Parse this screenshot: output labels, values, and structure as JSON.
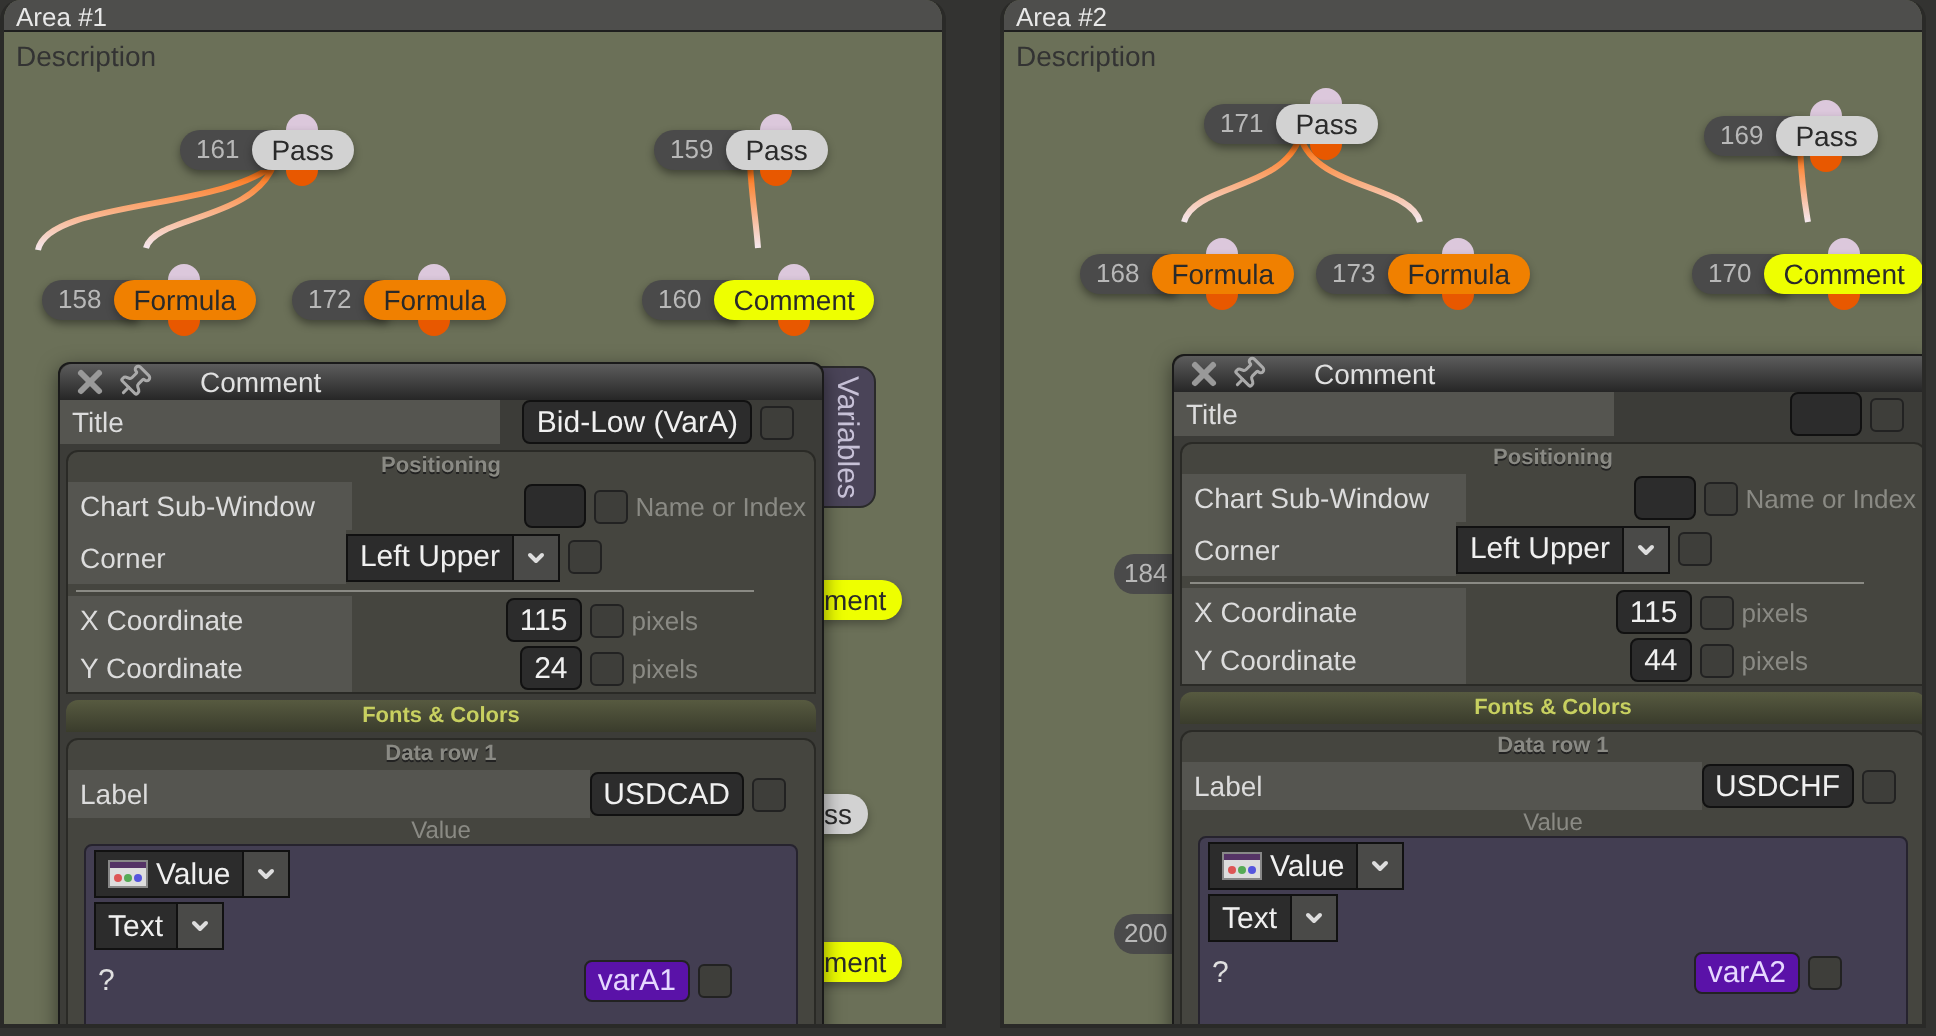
{
  "areas": [
    {
      "title": "Area #1",
      "description": "Description",
      "nodes": [
        {
          "number": "161",
          "label": "Pass",
          "kind": "pass"
        },
        {
          "number": "159",
          "label": "Pass",
          "kind": "pass"
        },
        {
          "number": "158",
          "label": "Formula",
          "kind": "formula"
        },
        {
          "number": "172",
          "label": "Formula",
          "kind": "formula"
        },
        {
          "number": "160",
          "label": "Comment",
          "kind": "comment"
        }
      ],
      "partial_nodes": [
        {
          "label": "ment",
          "kind": "comment"
        },
        {
          "label": "ss",
          "kind": "pass"
        },
        {
          "label": "ment",
          "kind": "comment"
        }
      ],
      "side_tab": "Variables",
      "dialog": {
        "title": "Comment",
        "title_row": {
          "label": "Title",
          "value": "Bid-Low (VarA)",
          "checked": false
        },
        "positioning": {
          "heading": "Positioning",
          "sub_window": {
            "label": "Chart Sub-Window",
            "hint": "Name or Index",
            "checked": false
          },
          "corner": {
            "label": "Corner",
            "value": "Left Upper",
            "checked": false
          },
          "x": {
            "label": "X Coordinate",
            "value": "115",
            "unit": "pixels",
            "checked": false
          },
          "y": {
            "label": "Y Coordinate",
            "value": "24",
            "unit": "pixels",
            "checked": false
          }
        },
        "fonts_heading": "Fonts & Colors",
        "data_row": {
          "heading": "Data row 1",
          "label_row": {
            "label": "Label",
            "value": "USDCAD",
            "checked": false
          },
          "value_caption": "Value",
          "source": "Value",
          "format": "Text",
          "variable": {
            "label": "?",
            "value": "varA1",
            "checked": false
          }
        }
      }
    },
    {
      "title": "Area #2",
      "description": "Description",
      "nodes": [
        {
          "number": "171",
          "label": "Pass",
          "kind": "pass"
        },
        {
          "number": "169",
          "label": "Pass",
          "kind": "pass"
        },
        {
          "number": "168",
          "label": "Formula",
          "kind": "formula"
        },
        {
          "number": "173",
          "label": "Formula",
          "kind": "formula"
        },
        {
          "number": "170",
          "label": "Comment",
          "kind": "comment"
        }
      ],
      "partial_nodes": [
        {
          "number": "184"
        },
        {
          "number": "200"
        }
      ],
      "dialog": {
        "title": "Comment",
        "title_row": {
          "label": "Title",
          "checked": false
        },
        "positioning": {
          "heading": "Positioning",
          "sub_window": {
            "label": "Chart Sub-Window",
            "hint": "Name or Index",
            "checked": false
          },
          "corner": {
            "label": "Corner",
            "value": "Left Upper",
            "checked": false
          },
          "x": {
            "label": "X Coordinate",
            "value": "115",
            "unit": "pixels",
            "checked": false
          },
          "y": {
            "label": "Y Coordinate",
            "value": "44",
            "unit": "pixels",
            "checked": false
          }
        },
        "fonts_heading": "Fonts & Colors",
        "data_row": {
          "heading": "Data row 1",
          "label_row": {
            "label": "Label",
            "value": "USDCHF",
            "checked": false
          },
          "value_caption": "Value",
          "source": "Value",
          "format": "Text",
          "variable": {
            "label": "?",
            "value": "varA2",
            "checked": false
          }
        }
      }
    }
  ]
}
